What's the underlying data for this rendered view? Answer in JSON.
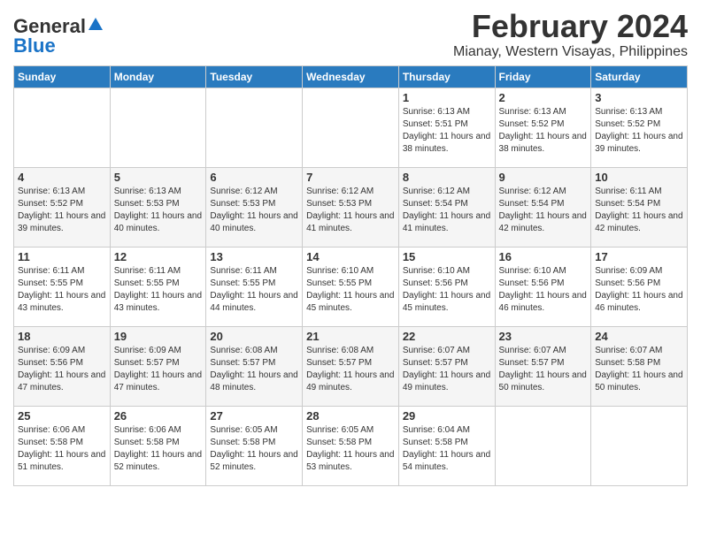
{
  "header": {
    "logo_general": "General",
    "logo_blue": "Blue",
    "month": "February 2024",
    "location": "Mianay, Western Visayas, Philippines"
  },
  "days_of_week": [
    "Sunday",
    "Monday",
    "Tuesday",
    "Wednesday",
    "Thursday",
    "Friday",
    "Saturday"
  ],
  "weeks": [
    [
      {
        "day": "",
        "info": ""
      },
      {
        "day": "",
        "info": ""
      },
      {
        "day": "",
        "info": ""
      },
      {
        "day": "",
        "info": ""
      },
      {
        "day": "1",
        "info": "Sunrise: 6:13 AM\nSunset: 5:51 PM\nDaylight: 11 hours and 38 minutes."
      },
      {
        "day": "2",
        "info": "Sunrise: 6:13 AM\nSunset: 5:52 PM\nDaylight: 11 hours and 38 minutes."
      },
      {
        "day": "3",
        "info": "Sunrise: 6:13 AM\nSunset: 5:52 PM\nDaylight: 11 hours and 39 minutes."
      }
    ],
    [
      {
        "day": "4",
        "info": "Sunrise: 6:13 AM\nSunset: 5:52 PM\nDaylight: 11 hours and 39 minutes."
      },
      {
        "day": "5",
        "info": "Sunrise: 6:13 AM\nSunset: 5:53 PM\nDaylight: 11 hours and 40 minutes."
      },
      {
        "day": "6",
        "info": "Sunrise: 6:12 AM\nSunset: 5:53 PM\nDaylight: 11 hours and 40 minutes."
      },
      {
        "day": "7",
        "info": "Sunrise: 6:12 AM\nSunset: 5:53 PM\nDaylight: 11 hours and 41 minutes."
      },
      {
        "day": "8",
        "info": "Sunrise: 6:12 AM\nSunset: 5:54 PM\nDaylight: 11 hours and 41 minutes."
      },
      {
        "day": "9",
        "info": "Sunrise: 6:12 AM\nSunset: 5:54 PM\nDaylight: 11 hours and 42 minutes."
      },
      {
        "day": "10",
        "info": "Sunrise: 6:11 AM\nSunset: 5:54 PM\nDaylight: 11 hours and 42 minutes."
      }
    ],
    [
      {
        "day": "11",
        "info": "Sunrise: 6:11 AM\nSunset: 5:55 PM\nDaylight: 11 hours and 43 minutes."
      },
      {
        "day": "12",
        "info": "Sunrise: 6:11 AM\nSunset: 5:55 PM\nDaylight: 11 hours and 43 minutes."
      },
      {
        "day": "13",
        "info": "Sunrise: 6:11 AM\nSunset: 5:55 PM\nDaylight: 11 hours and 44 minutes."
      },
      {
        "day": "14",
        "info": "Sunrise: 6:10 AM\nSunset: 5:55 PM\nDaylight: 11 hours and 45 minutes."
      },
      {
        "day": "15",
        "info": "Sunrise: 6:10 AM\nSunset: 5:56 PM\nDaylight: 11 hours and 45 minutes."
      },
      {
        "day": "16",
        "info": "Sunrise: 6:10 AM\nSunset: 5:56 PM\nDaylight: 11 hours and 46 minutes."
      },
      {
        "day": "17",
        "info": "Sunrise: 6:09 AM\nSunset: 5:56 PM\nDaylight: 11 hours and 46 minutes."
      }
    ],
    [
      {
        "day": "18",
        "info": "Sunrise: 6:09 AM\nSunset: 5:56 PM\nDaylight: 11 hours and 47 minutes."
      },
      {
        "day": "19",
        "info": "Sunrise: 6:09 AM\nSunset: 5:57 PM\nDaylight: 11 hours and 47 minutes."
      },
      {
        "day": "20",
        "info": "Sunrise: 6:08 AM\nSunset: 5:57 PM\nDaylight: 11 hours and 48 minutes."
      },
      {
        "day": "21",
        "info": "Sunrise: 6:08 AM\nSunset: 5:57 PM\nDaylight: 11 hours and 49 minutes."
      },
      {
        "day": "22",
        "info": "Sunrise: 6:07 AM\nSunset: 5:57 PM\nDaylight: 11 hours and 49 minutes."
      },
      {
        "day": "23",
        "info": "Sunrise: 6:07 AM\nSunset: 5:57 PM\nDaylight: 11 hours and 50 minutes."
      },
      {
        "day": "24",
        "info": "Sunrise: 6:07 AM\nSunset: 5:58 PM\nDaylight: 11 hours and 50 minutes."
      }
    ],
    [
      {
        "day": "25",
        "info": "Sunrise: 6:06 AM\nSunset: 5:58 PM\nDaylight: 11 hours and 51 minutes."
      },
      {
        "day": "26",
        "info": "Sunrise: 6:06 AM\nSunset: 5:58 PM\nDaylight: 11 hours and 52 minutes."
      },
      {
        "day": "27",
        "info": "Sunrise: 6:05 AM\nSunset: 5:58 PM\nDaylight: 11 hours and 52 minutes."
      },
      {
        "day": "28",
        "info": "Sunrise: 6:05 AM\nSunset: 5:58 PM\nDaylight: 11 hours and 53 minutes."
      },
      {
        "day": "29",
        "info": "Sunrise: 6:04 AM\nSunset: 5:58 PM\nDaylight: 11 hours and 54 minutes."
      },
      {
        "day": "",
        "info": ""
      },
      {
        "day": "",
        "info": ""
      }
    ]
  ]
}
